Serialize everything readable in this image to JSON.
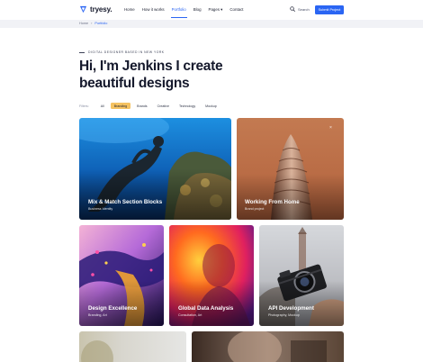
{
  "header": {
    "brand": "tryesy.",
    "nav": [
      "Home",
      "How it works",
      "Portfolio",
      "Blog",
      "Pages ▾",
      "Contact"
    ],
    "active_nav_index": 2,
    "search_label": "Search",
    "submit_label": "Submit Project"
  },
  "breadcrumb": {
    "home": "Home",
    "separator": "›",
    "current": "Portfolio"
  },
  "hero": {
    "eyebrow": "DIGITAL DESIGNER BASED IN NEW YORK",
    "title_line1": "Hi, I'm Jenkins I create",
    "title_line2": "beautiful designs"
  },
  "filters": {
    "label": "Filters:",
    "chips": [
      "All",
      "Branding",
      "Brands",
      "Creative",
      "Technology",
      "Mockup"
    ],
    "active_index": 1
  },
  "cards": [
    {
      "title": "Mix & Match Section Blocks",
      "subtitle": "Business Identity"
    },
    {
      "title": "Working From Home",
      "subtitle": "Brand project"
    },
    {
      "title": "Design Excellence",
      "subtitle": "Branding, Art"
    },
    {
      "title": "Global Data Analysis",
      "subtitle": "Consultation, Art"
    },
    {
      "title": "API Development",
      "subtitle": "Photography, Mockup"
    }
  ],
  "close_glyph": "×",
  "colors": {
    "accent": "#2a65f3",
    "chip_active": "#f5c261",
    "text": "#15192c"
  },
  "icons": {
    "logo": "tryesy-logo-icon",
    "search": "search-icon"
  }
}
